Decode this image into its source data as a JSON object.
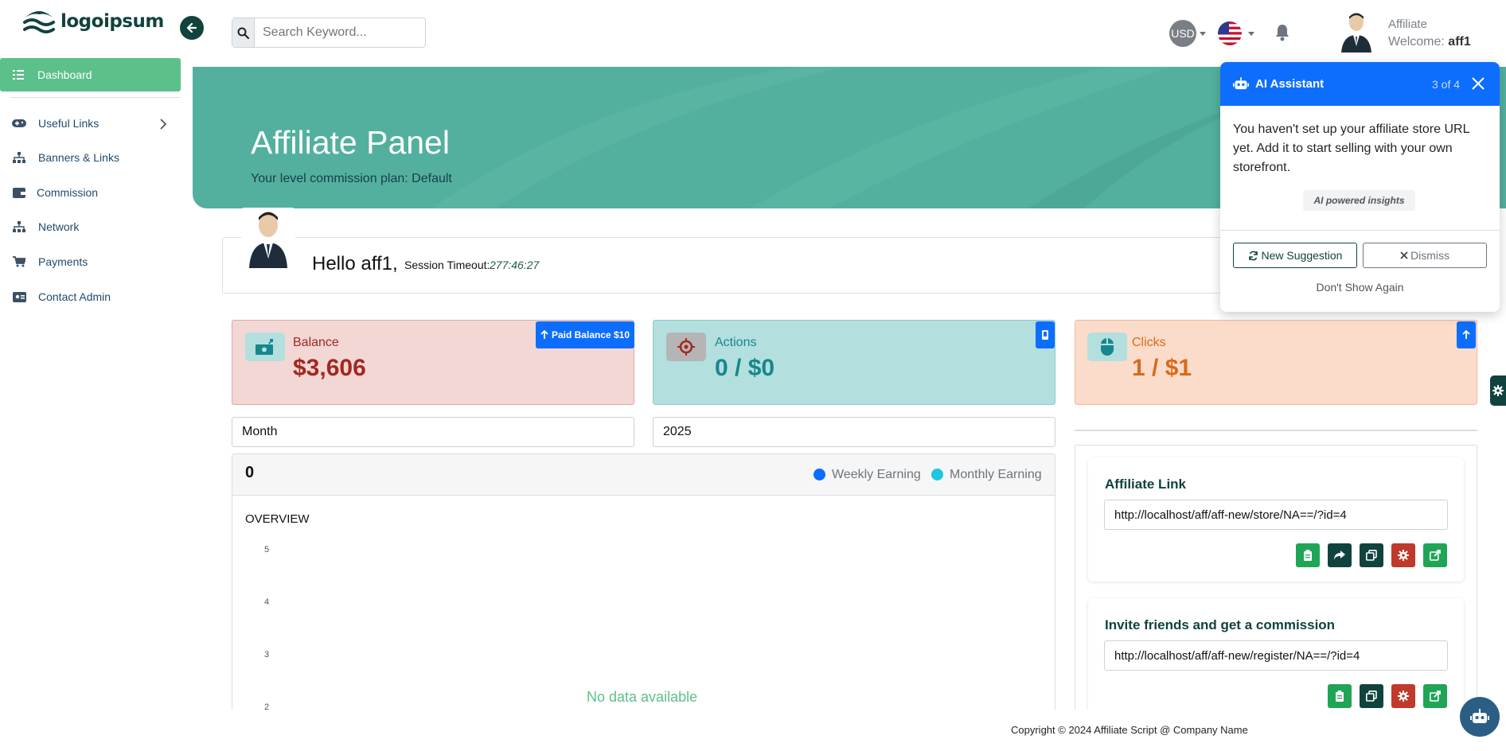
{
  "brand": {
    "name": "logoipsum"
  },
  "sidebar": {
    "items": [
      {
        "label": "Dashboard",
        "icon": "list-icon"
      },
      {
        "label": "Useful Links",
        "icon": "gamepad-icon"
      },
      {
        "label": "Banners & Links",
        "icon": "sitemap-icon"
      },
      {
        "label": "Commission",
        "icon": "wallet-icon"
      },
      {
        "label": "Network",
        "icon": "sitemap-icon"
      },
      {
        "label": "Payments",
        "icon": "cart-icon"
      },
      {
        "label": "Contact Admin",
        "icon": "id-card-icon"
      }
    ]
  },
  "header": {
    "search_placeholder": "Search Keyword...",
    "currency": "USD",
    "user_role": "Affiliate",
    "welcome_label": "Welcome:",
    "username": "aff1"
  },
  "banner": {
    "title": "Affiliate Panel",
    "subtitle": "Your level commission plan: Default"
  },
  "hello": {
    "greeting": "Hello aff1,",
    "session_label": "Session Timeout:",
    "session_value": "277:46:27"
  },
  "stats": {
    "balance": {
      "label": "Balance",
      "value": "$3,606",
      "button": "Paid Balance $10"
    },
    "actions": {
      "label": "Actions",
      "value": "0 / $0"
    },
    "clicks": {
      "label": "Clicks",
      "value": "1 / $1"
    }
  },
  "filters": {
    "month": "Month",
    "year": "2025"
  },
  "chart": {
    "total": "0",
    "legend": [
      "Weekly Earning",
      "Monthly Earning"
    ],
    "section": "OVERVIEW",
    "empty_message": "No data available"
  },
  "chart_data": {
    "type": "line",
    "series": [
      {
        "name": "Weekly Earning",
        "values": []
      },
      {
        "name": "Monthly Earning",
        "values": []
      }
    ],
    "yticks": [
      "5",
      "4",
      "3",
      "2"
    ]
  },
  "links": {
    "affiliate": {
      "title": "Affiliate Link",
      "url": "http://localhost/aff/aff-new/store/NA==/?id=4"
    },
    "invite": {
      "title": "Invite friends and get a commission",
      "url": "http://localhost/aff/aff-new/register/NA==/?id=4"
    }
  },
  "ai": {
    "title": "AI Assistant",
    "count": "3 of 4",
    "message": "You haven't set up your affiliate store URL yet. Add it to start selling with your own storefront.",
    "badge": "AI powered insights",
    "new_button": "New Suggestion",
    "dismiss_button": "Dismiss",
    "dont_show": "Don't Show Again"
  },
  "footer": {
    "copyright": "Copyright © 2024 Affiliate Script @ Company Name"
  },
  "colors": {
    "primary_green": "#11433e",
    "accent_green": "#5cc08b",
    "banner_teal": "#53b09e",
    "blue": "#0d6efd",
    "balance_bg": "#f2d7d5",
    "balance_text": "#a3271f",
    "actions_bg": "#b3dfdf",
    "actions_text": "#17878c",
    "clicks_bg": "#fbdcca",
    "clicks_text": "#d96a1a"
  }
}
